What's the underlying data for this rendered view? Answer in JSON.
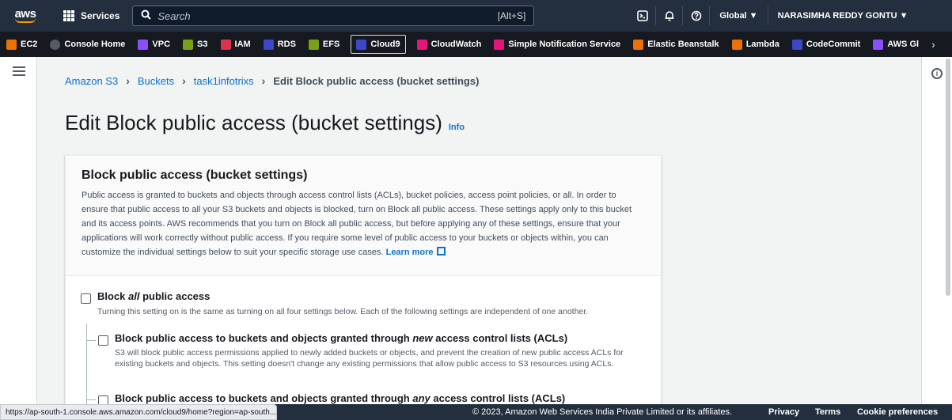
{
  "topnav": {
    "logo": "aws",
    "services_label": "Services",
    "search_placeholder": "Search",
    "search_shortcut": "[Alt+S]",
    "region": "Global ▼",
    "account": "NARASIMHA REDDY GONTU ▼"
  },
  "favorites": [
    {
      "label": "EC2",
      "color": "#ed7100"
    },
    {
      "label": "Console Home",
      "color": "#545b64"
    },
    {
      "label": "VPC",
      "color": "#8c4fff"
    },
    {
      "label": "S3",
      "color": "#7aa116"
    },
    {
      "label": "IAM",
      "color": "#dd344c"
    },
    {
      "label": "RDS",
      "color": "#3b48cc"
    },
    {
      "label": "EFS",
      "color": "#7aa116"
    },
    {
      "label": "Cloud9",
      "color": "#3b48cc"
    },
    {
      "label": "CloudWatch",
      "color": "#e7157b"
    },
    {
      "label": "Simple Notification Service",
      "color": "#e7157b"
    },
    {
      "label": "Elastic Beanstalk",
      "color": "#ed7100"
    },
    {
      "label": "Lambda",
      "color": "#ed7100"
    },
    {
      "label": "CodeCommit",
      "color": "#3b48cc"
    },
    {
      "label": "AWS Gl",
      "color": "#8c4fff"
    }
  ],
  "breadcrumb": {
    "item1": "Amazon S3",
    "item2": "Buckets",
    "item3": "task1infotrixs",
    "current": "Edit Block public access (bucket settings)"
  },
  "page": {
    "title": "Edit Block public access (bucket settings)",
    "info": "Info"
  },
  "panel": {
    "title": "Block public access (bucket settings)",
    "description": "Public access is granted to buckets and objects through access control lists (ACLs), bucket policies, access point policies, or all. In order to ensure that public access to all your S3 buckets and objects is blocked, turn on Block all public access. These settings apply only to this bucket and its access points. AWS recommends that you turn on Block all public access, but before applying any of these settings, ensure that your applications will work correctly without public access. If you require some level of public access to your buckets or objects within, you can customize the individual settings below to suit your specific storage use cases.",
    "learn_more": "Learn more"
  },
  "options": {
    "all": {
      "title_pre": "Block ",
      "title_em": "all",
      "title_post": " public access",
      "desc": "Turning this setting on is the same as turning on all four settings below. Each of the following settings are independent of one another.",
      "checked": false
    },
    "new_acl": {
      "title_pre": "Block public access to buckets and objects granted through ",
      "title_em": "new",
      "title_post": " access control lists (ACLs)",
      "desc": "S3 will block public access permissions applied to newly added buckets or objects, and prevent the creation of new public access ACLs for existing buckets and objects. This setting doesn't change any existing permissions that allow public access to S3 resources using ACLs.",
      "checked": false
    },
    "any_acl": {
      "title_pre": "Block public access to buckets and objects granted through ",
      "title_em": "any",
      "title_post": " access control lists (ACLs)",
      "checked": false
    }
  },
  "footer": {
    "status_url": "https://ap-south-1.console.aws.amazon.com/cloud9/home?region=ap-south...",
    "copyright": "© 2023, Amazon Web Services India Private Limited or its affiliates.",
    "privacy": "Privacy",
    "terms": "Terms",
    "cookie": "Cookie preferences"
  }
}
